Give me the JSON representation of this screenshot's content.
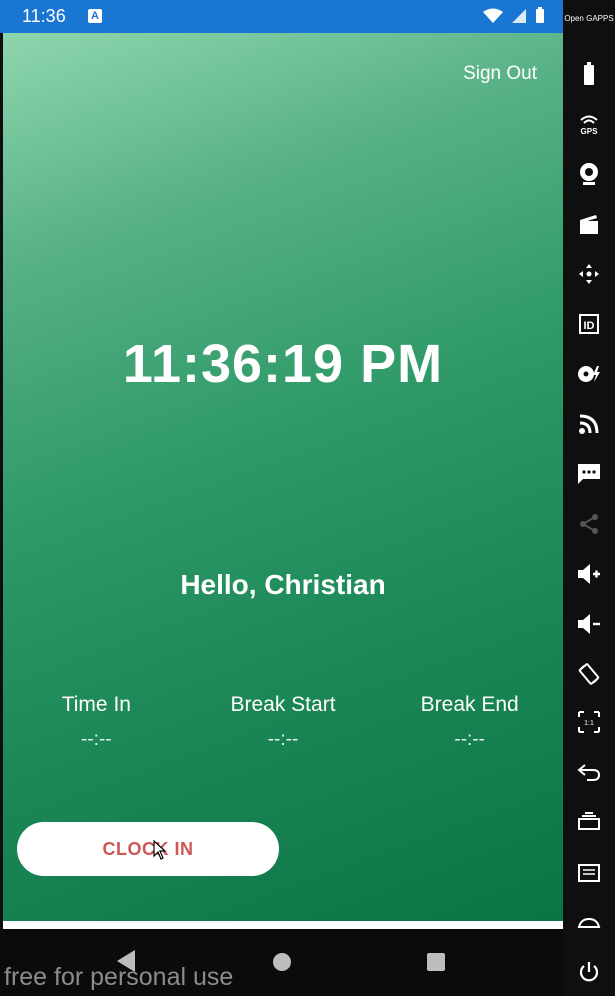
{
  "status_bar": {
    "time": "11:36",
    "notification_letter": "A"
  },
  "app": {
    "sign_out_label": "Sign Out",
    "clock": "11:36:19 PM",
    "greeting": "Hello, Christian",
    "stats": [
      {
        "label": "Time In",
        "value": "--:--"
      },
      {
        "label": "Break Start",
        "value": "--:--"
      },
      {
        "label": "Break End",
        "value": "--:--"
      }
    ],
    "clock_in_label": "CLOCK IN"
  },
  "watermark": "free for personal use",
  "emulator_sidebar": {
    "top_label": "Open GAPPS",
    "scale_label": "1:1",
    "icons": [
      "battery-icon",
      "gps-icon",
      "webcam-icon",
      "clapperboard-icon",
      "move-icon",
      "id-icon",
      "disk-flash-icon",
      "rss-icon",
      "sms-icon",
      "share-icon",
      "volume-up-icon",
      "volume-down-icon",
      "rotate-icon",
      "scale-icon",
      "back-icon",
      "recent-apps-icon",
      "menu-icon",
      "home-icon",
      "power-icon"
    ]
  },
  "colors": {
    "status_bar": "#1976d2",
    "gradient_top": "#8ed6ad",
    "gradient_bottom": "#0b7444",
    "clock_in_text": "#cf5656"
  }
}
